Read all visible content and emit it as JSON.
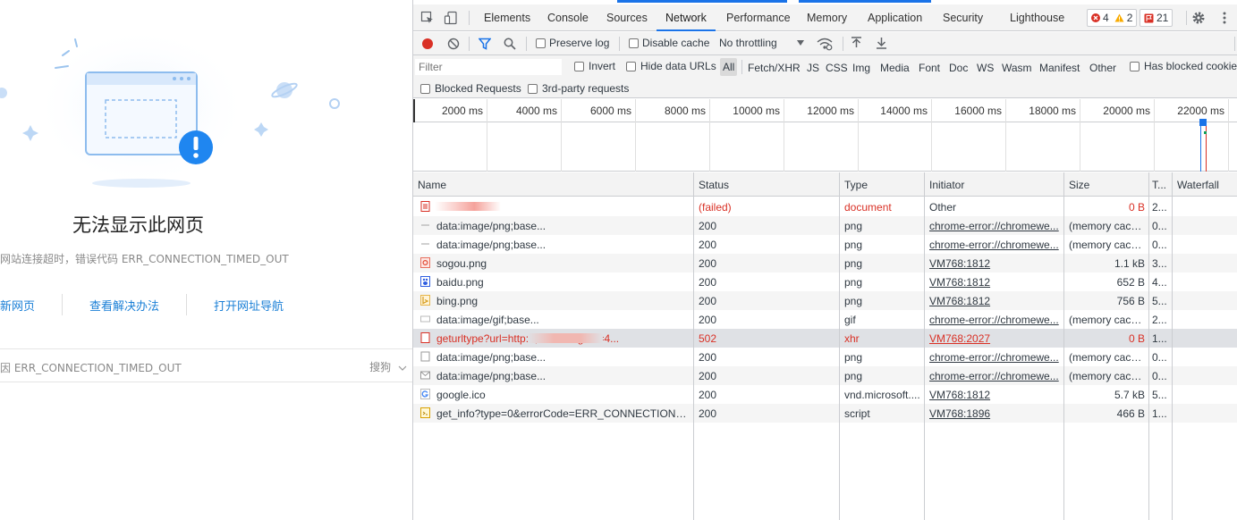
{
  "error_page": {
    "title": "无法显示此网页",
    "description": "网站连接超时，错误代码 ERR_CONNECTION_TIMED_OUT",
    "actions": [
      "新网页",
      "查看解决办法",
      "打开网址导航"
    ],
    "reason": "因 ERR_CONNECTION_TIMED_OUT",
    "search_engine": "搜狗"
  },
  "devtools": {
    "tabs": [
      "Elements",
      "Console",
      "Sources",
      "Network",
      "Performance",
      "Memory",
      "Application",
      "Security",
      "Lighthouse"
    ],
    "active_tab": "Network",
    "badges": {
      "errors": "4",
      "warnings": "2",
      "issues": "21"
    },
    "toolbar": {
      "preserve_log": "Preserve log",
      "disable_cache": "Disable cache",
      "throttling": "No throttling"
    },
    "filter": {
      "placeholder": "Filter",
      "invert": "Invert",
      "hide_data_urls": "Hide data URLs",
      "types": [
        "All",
        "Fetch/XHR",
        "JS",
        "CSS",
        "Img",
        "Media",
        "Font",
        "Doc",
        "WS",
        "Wasm",
        "Manifest",
        "Other"
      ],
      "has_blocked_cookies": "Has blocked cookies",
      "blocked_requests": "Blocked Requests",
      "third_party": "3rd-party requests"
    },
    "timeline_ticks": [
      "2000 ms",
      "4000 ms",
      "6000 ms",
      "8000 ms",
      "10000 ms",
      "12000 ms",
      "14000 ms",
      "16000 ms",
      "18000 ms",
      "20000 ms",
      "22000 ms"
    ],
    "columns": [
      "Name",
      "Status",
      "Type",
      "Initiator",
      "Size",
      "T...",
      "Waterfall"
    ],
    "rows": [
      {
        "icon": "document-icon",
        "name": "",
        "status": "(failed)",
        "type": "document",
        "initiator": "Other",
        "initiator_link": false,
        "size": "0 B",
        "time": "2...",
        "error": true
      },
      {
        "icon": "image-dash-icon",
        "name": "data:image/png;base...",
        "status": "200",
        "type": "png",
        "initiator": "chrome-error://chromewe...",
        "initiator_link": true,
        "size": "(memory cache)",
        "time": "0...",
        "error": false
      },
      {
        "icon": "image-dash-icon",
        "name": "data:image/png;base...",
        "status": "200",
        "type": "png",
        "initiator": "chrome-error://chromewe...",
        "initiator_link": true,
        "size": "(memory cache)",
        "time": "0...",
        "error": false
      },
      {
        "icon": "sogou-favicon-icon",
        "name": "sogou.png",
        "status": "200",
        "type": "png",
        "initiator": "VM768:1812",
        "initiator_link": true,
        "size": "1.1 kB",
        "time": "3...",
        "error": false
      },
      {
        "icon": "baidu-favicon-icon",
        "name": "baidu.png",
        "status": "200",
        "type": "png",
        "initiator": "VM768:1812",
        "initiator_link": true,
        "size": "652 B",
        "time": "4...",
        "error": false
      },
      {
        "icon": "bing-favicon-icon",
        "name": "bing.png",
        "status": "200",
        "type": "png",
        "initiator": "VM768:1812",
        "initiator_link": true,
        "size": "756 B",
        "time": "5...",
        "error": false
      },
      {
        "icon": "gif-icon",
        "name": "data:image/gif;base...",
        "status": "200",
        "type": "gif",
        "initiator": "chrome-error://chromewe...",
        "initiator_link": true,
        "size": "(memory cache)",
        "time": "2...",
        "error": false
      },
      {
        "icon": "failed-request-icon",
        "name": "geturltype?url=http://,                    .8688/&guid=4...",
        "status": "502",
        "type": "xhr",
        "initiator": "VM768:2027",
        "initiator_link": true,
        "size": "0 B",
        "time": "1...",
        "error": true
      },
      {
        "icon": "blank-image-icon",
        "name": "data:image/png;base...",
        "status": "200",
        "type": "png",
        "initiator": "chrome-error://chromewe...",
        "initiator_link": true,
        "size": "(memory cache)",
        "time": "0...",
        "error": false
      },
      {
        "icon": "envelope-image-icon",
        "name": "data:image/png;base...",
        "status": "200",
        "type": "png",
        "initiator": "chrome-error://chromewe...",
        "initiator_link": true,
        "size": "(memory cache)",
        "time": "0...",
        "error": false
      },
      {
        "icon": "google-favicon-icon",
        "name": "google.ico",
        "status": "200",
        "type": "vnd.microsoft....",
        "initiator": "VM768:1812",
        "initiator_link": true,
        "size": "5.7 kB",
        "time": "5...",
        "error": false
      },
      {
        "icon": "script-icon",
        "name": "get_info?type=0&errorCode=ERR_CONNECTION_TI...",
        "status": "200",
        "type": "script",
        "initiator": "VM768:1896",
        "initiator_link": true,
        "size": "466 B",
        "time": "1...",
        "error": false
      }
    ]
  }
}
